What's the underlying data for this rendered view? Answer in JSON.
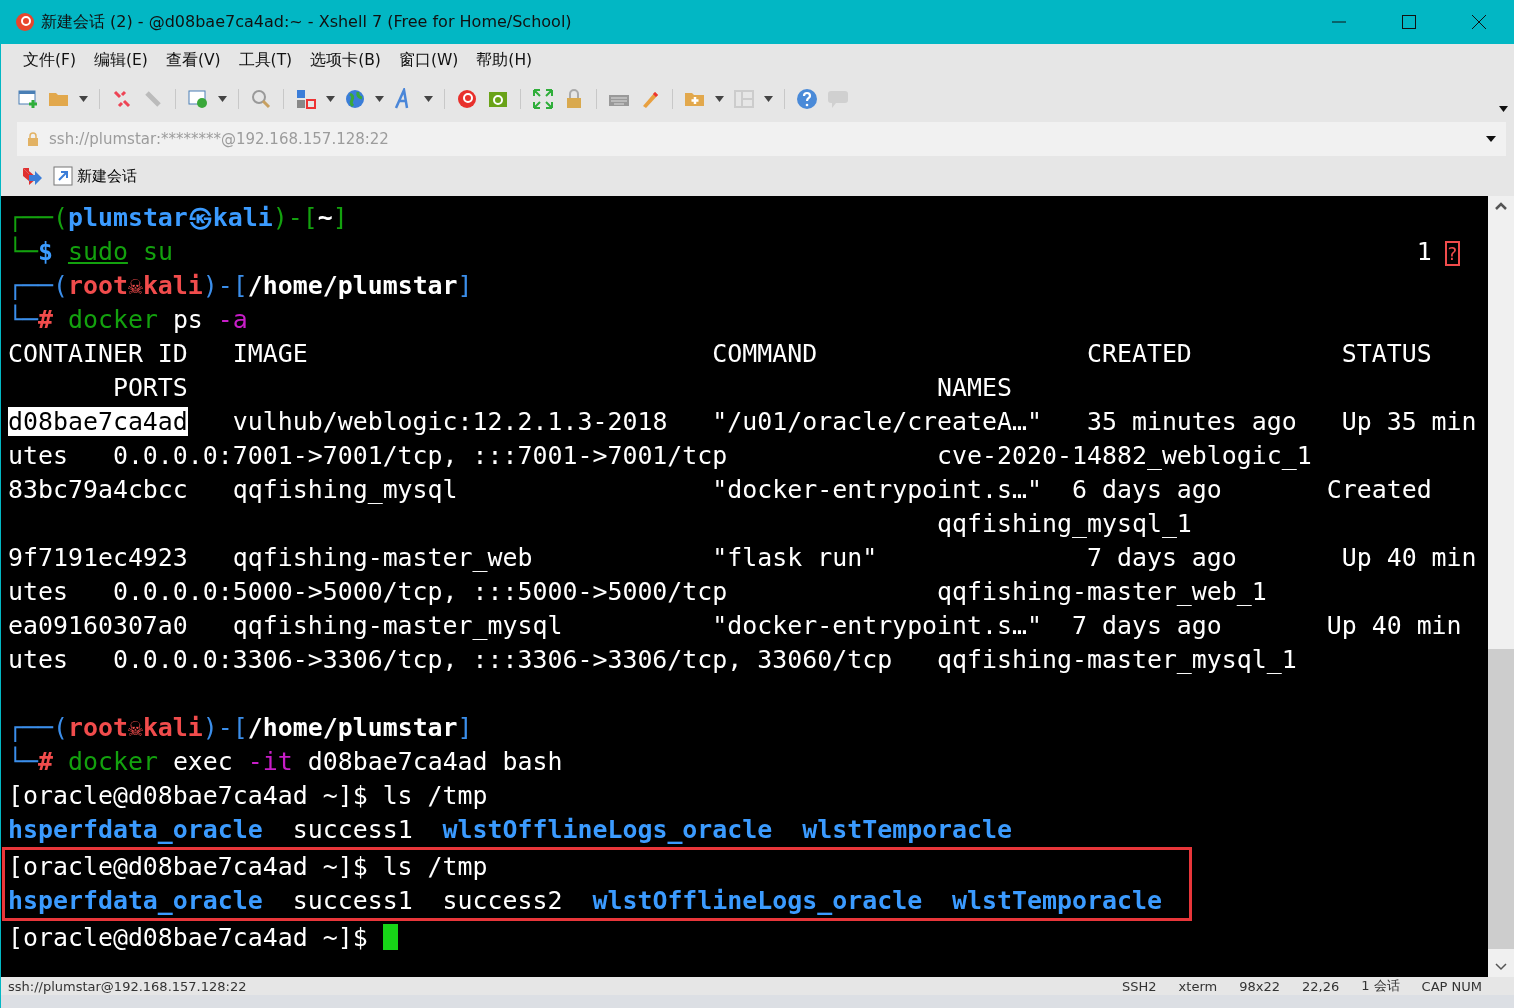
{
  "window": {
    "title": "新建会话 (2) - @d08bae7ca4ad:~ - Xshell 7 (Free for Home/School)"
  },
  "menu": [
    "文件(F)",
    "编辑(E)",
    "查看(V)",
    "工具(T)",
    "选项卡(B)",
    "窗口(W)",
    "帮助(H)"
  ],
  "address": {
    "value": "ssh://plumstar:********@192.168.157.128:22"
  },
  "session_tabs": [
    {
      "label": "新建会话",
      "selected": true
    }
  ],
  "terminal": {
    "lines": [
      {
        "kind": "plain",
        "segments": [
          {
            "text": "┌──(",
            "kind": "green"
          },
          {
            "text": "plumstar㉿kali",
            "kind": "bluebold"
          },
          {
            "text": ")-[",
            "kind": "green"
          },
          {
            "text": "~",
            "kind": "whitebold"
          },
          {
            "text": "]",
            "kind": "green"
          }
        ]
      },
      {
        "kind": "plain",
        "segments": [
          {
            "text": "└─",
            "kind": "green"
          },
          {
            "text": "$ ",
            "kind": "bluebold"
          },
          {
            "text": "sudo",
            "kind": "greenunder"
          },
          {
            "text": " su",
            "kind": "green"
          },
          {
            "text": "                                                                                   1 ",
            "kind": "white"
          },
          {
            "text": "?",
            "kind": "redbox"
          }
        ]
      },
      {
        "kind": "plain",
        "segments": [
          {
            "text": "┌──(",
            "kind": "blue"
          },
          {
            "text": "root☠kali",
            "kind": "redbold"
          },
          {
            "text": ")-[",
            "kind": "blue"
          },
          {
            "text": "/home/plumstar",
            "kind": "whitebold"
          },
          {
            "text": "]",
            "kind": "blue"
          }
        ]
      },
      {
        "kind": "plain",
        "segments": [
          {
            "text": "└─",
            "kind": "blue"
          },
          {
            "text": "#",
            "kind": "redbold"
          },
          {
            "text": " docker",
            "kind": "green"
          },
          {
            "text": " ps",
            "kind": "white"
          },
          {
            "text": " -a",
            "kind": "magenta"
          }
        ]
      },
      {
        "kind": "plain",
        "segments": [
          {
            "text": "CONTAINER ID   IMAGE                           COMMAND                  CREATED          STATUS",
            "kind": "white"
          }
        ]
      },
      {
        "kind": "plain",
        "segments": [
          {
            "text": "       PORTS                                                  NAMES",
            "kind": "white"
          }
        ]
      },
      {
        "kind": "plain",
        "segments": [
          {
            "text": "d08bae7ca4ad",
            "kind": "selected"
          },
          {
            "text": "   vulhub/weblogic:12.2.1.3-2018   \"/u01/oracle/createA…\"   35 minutes ago   Up 35 min",
            "kind": "white"
          }
        ]
      },
      {
        "kind": "plain",
        "segments": [
          {
            "text": "utes   0.0.0.0:7001->7001/tcp, :::7001->7001/tcp              cve-2020-14882_weblogic_1",
            "kind": "white"
          }
        ]
      },
      {
        "kind": "plain",
        "segments": [
          {
            "text": "83bc79a4cbcc   qqfishing_mysql                 \"docker-entrypoint.s…\"  6 days ago       Created",
            "kind": "white"
          }
        ]
      },
      {
        "kind": "plain",
        "segments": [
          {
            "text": "                                                              qqfishing_mysql_1",
            "kind": "white"
          }
        ]
      },
      {
        "kind": "plain",
        "segments": [
          {
            "text": "9f7191ec4923   qqfishing-master_web            \"flask run\"              7 days ago       Up 40 min",
            "kind": "white"
          }
        ]
      },
      {
        "kind": "plain",
        "segments": [
          {
            "text": "utes   0.0.0.0:5000->5000/tcp, :::5000->5000/tcp              qqfishing-master_web_1",
            "kind": "white"
          }
        ]
      },
      {
        "kind": "plain",
        "segments": [
          {
            "text": "ea09160307a0   qqfishing-master_mysql          \"docker-entrypoint.s…\"  7 days ago       Up 40 min",
            "kind": "white"
          }
        ]
      },
      {
        "kind": "plain",
        "segments": [
          {
            "text": "utes   0.0.0.0:3306->3306/tcp, :::3306->3306/tcp, 33060/tcp   qqfishing-master_mysql_1",
            "kind": "white"
          }
        ]
      },
      {
        "kind": "blank"
      },
      {
        "kind": "plain",
        "segments": [
          {
            "text": "┌──(",
            "kind": "blue"
          },
          {
            "text": "root☠kali",
            "kind": "redbold"
          },
          {
            "text": ")-[",
            "kind": "blue"
          },
          {
            "text": "/home/plumstar",
            "kind": "whitebold"
          },
          {
            "text": "]",
            "kind": "blue"
          }
        ]
      },
      {
        "kind": "plain",
        "segments": [
          {
            "text": "└─",
            "kind": "blue"
          },
          {
            "text": "#",
            "kind": "redbold"
          },
          {
            "text": " docker",
            "kind": "green"
          },
          {
            "text": " exec",
            "kind": "white"
          },
          {
            "text": " -it",
            "kind": "magenta"
          },
          {
            "text": " d08bae7ca4ad bash",
            "kind": "white"
          }
        ]
      },
      {
        "kind": "plain",
        "segments": [
          {
            "text": "[oracle@d08bae7ca4ad ~]$ ls /tmp",
            "kind": "white"
          }
        ]
      },
      {
        "kind": "plain",
        "segments": [
          {
            "text": "hsperfdata_oracle",
            "kind": "bluebold"
          },
          {
            "text": "  success1  ",
            "kind": "white"
          },
          {
            "text": "wlstOfflineLogs_oracle  ",
            "kind": "bluebold"
          },
          {
            "text": "wlstTemporacle",
            "kind": "bluebold"
          }
        ]
      },
      {
        "kind": "boxed",
        "segments": [
          {
            "text": "[oracle@d08bae7ca4ad ~]$ ls /tmp",
            "kind": "white"
          }
        ]
      },
      {
        "kind": "boxed",
        "segments": [
          {
            "text": "hsperfdata_oracle",
            "kind": "bluebold"
          },
          {
            "text": "  success1  success2  ",
            "kind": "white"
          },
          {
            "text": "wlstOfflineLogs_oracle  ",
            "kind": "bluebold"
          },
          {
            "text": "wlstTemporacle",
            "kind": "bluebold"
          }
        ]
      },
      {
        "kind": "cursor",
        "segments": [
          {
            "text": "[oracle@d08bae7ca4ad ~]$ ",
            "kind": "white"
          }
        ]
      }
    ]
  },
  "status_bar": [
    "ssh://plumstar@192.168.157.128:22",
    "SSH2",
    "xterm",
    "98x22",
    "22,26",
    "1 会话",
    "CAP NUM"
  ]
}
